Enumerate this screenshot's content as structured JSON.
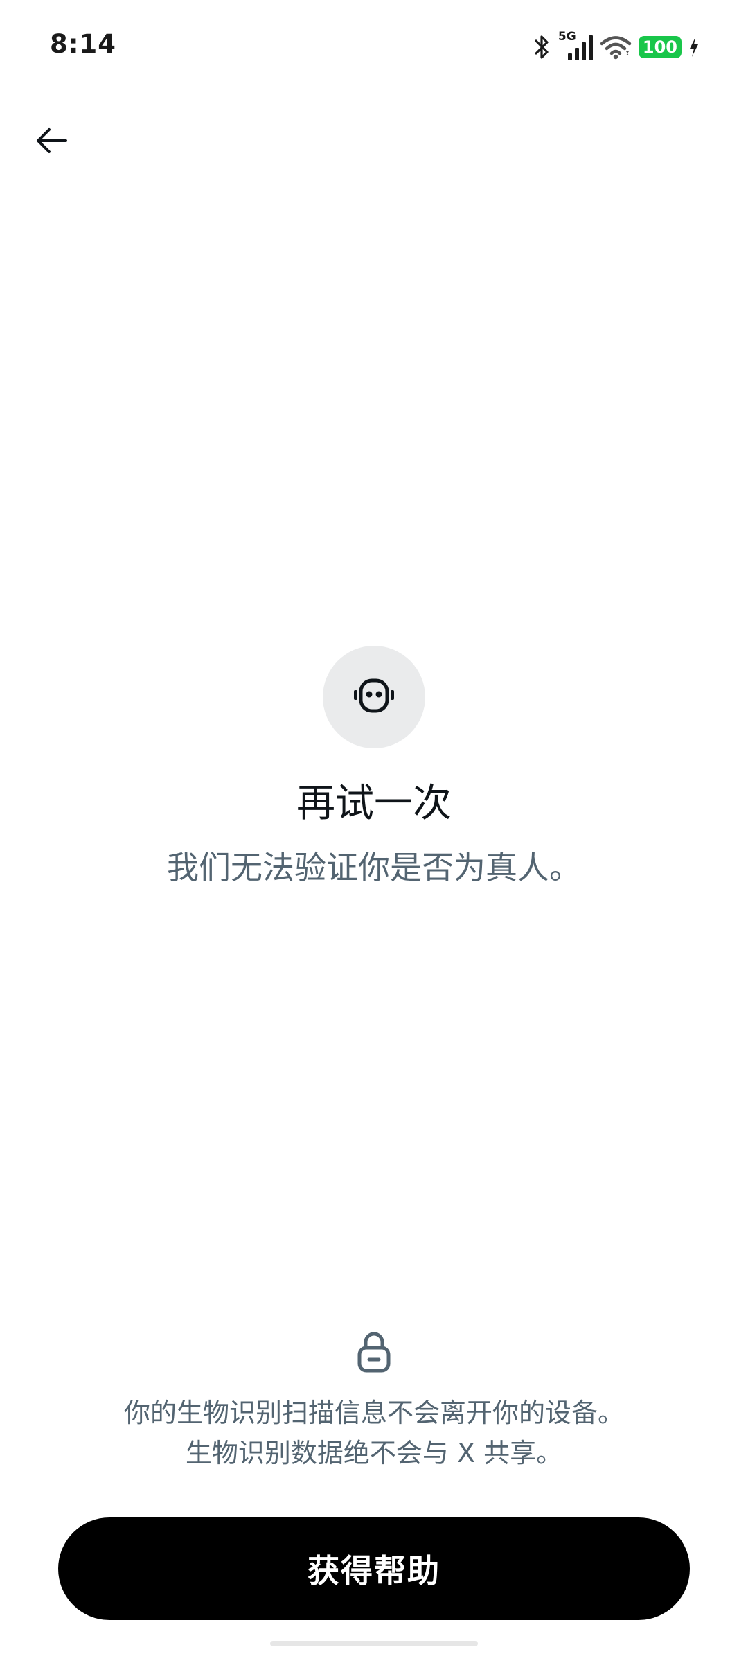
{
  "status_bar": {
    "time": "8:14",
    "network": "5G",
    "battery": "100",
    "battery_color": "#19c64a"
  },
  "navigation": {
    "back_icon": "arrow-left-icon"
  },
  "main": {
    "icon": "robot-icon",
    "title": "再试一次",
    "subtitle": "我们无法验证你是否为真人。"
  },
  "privacy": {
    "icon": "lock-icon",
    "line1": "你的生物识别扫描信息不会离开你的设备。",
    "line2": "生物识别数据绝不会与 X 共享。"
  },
  "actions": {
    "help_label": "获得帮助"
  },
  "colors": {
    "primary_text": "#0f1419",
    "secondary_text": "#536471",
    "button_bg": "#000000",
    "icon_circle_bg": "#eaebec"
  }
}
